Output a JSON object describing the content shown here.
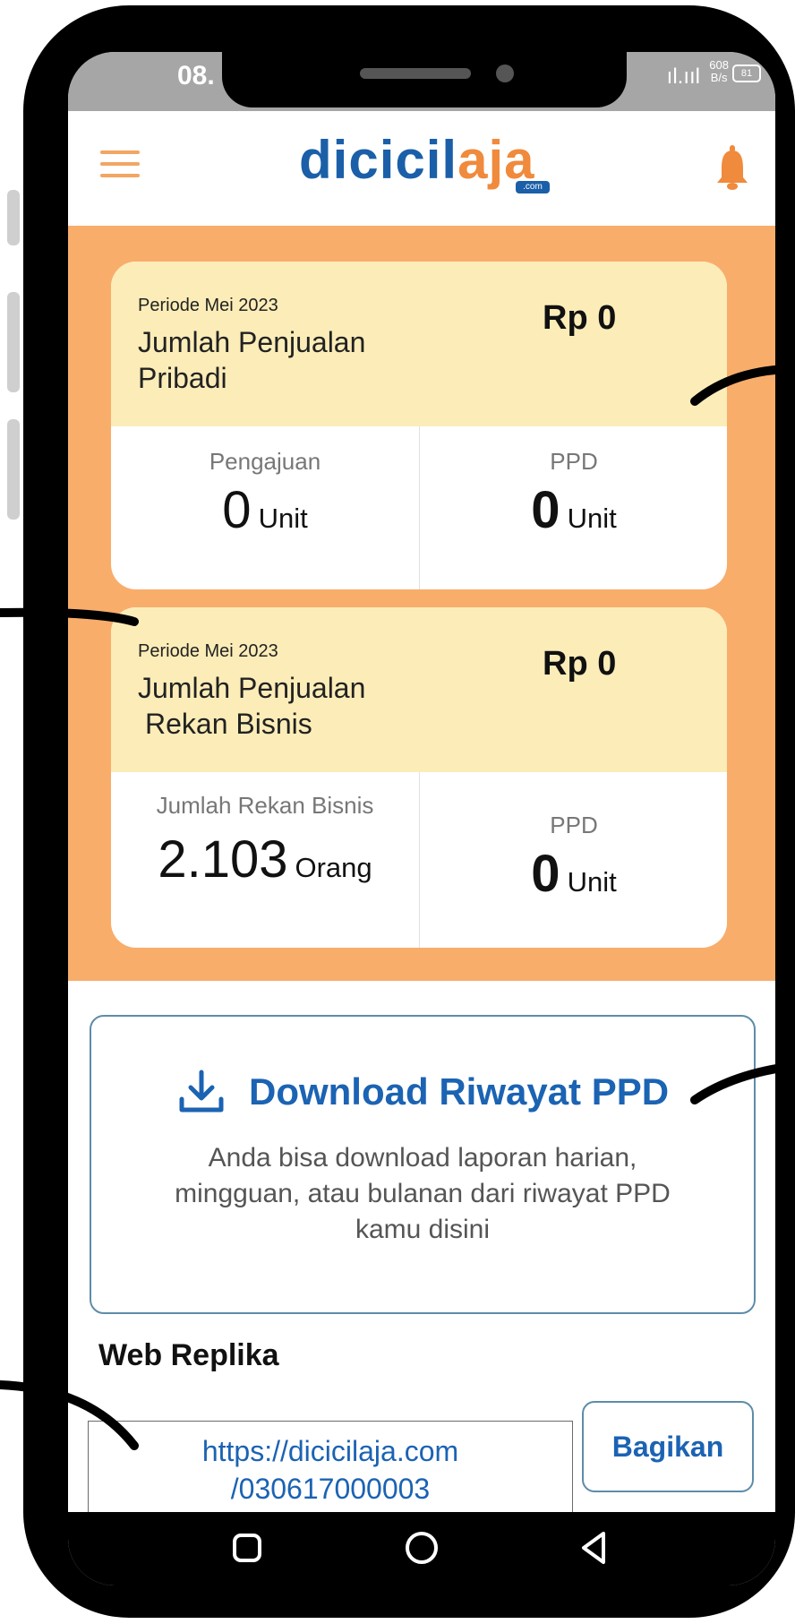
{
  "status_bar": {
    "time": "08.",
    "signal": "ıl.ııl",
    "net_speed_value": "608",
    "net_speed_unit": "B/s",
    "battery": "81"
  },
  "header": {
    "logo_part1": "dicicil",
    "logo_part2": "aja",
    "logo_suffix": ".com",
    "menu_icon": "hamburger-icon",
    "bell_icon": "bell-icon"
  },
  "personal_sales": {
    "period": "Periode Mei 2023",
    "title_line1": "Jumlah Penjualan",
    "title_line2": "Pribadi",
    "amount": "Rp 0",
    "left_label": "Pengajuan",
    "left_value": "0",
    "left_unit": "Unit",
    "right_label": "PPD",
    "right_value": "0",
    "right_unit": "Unit"
  },
  "partner_sales": {
    "period": "Periode Mei 2023",
    "title_line1": "Jumlah Penjualan",
    "title_line2": "Rekan Bisnis",
    "amount": "Rp 0",
    "left_label": "Jumlah Rekan Bisnis",
    "left_value": "2.103",
    "left_unit": "Orang",
    "right_label": "PPD",
    "right_value": "0",
    "right_unit": "Unit"
  },
  "download": {
    "title": "Download Riwayat PPD",
    "description": "Anda bisa download laporan harian, mingguan, atau bulanan dari riwayat PPD kamu disini",
    "icon": "download-icon"
  },
  "web_replika": {
    "heading": "Web Replika",
    "url_line1": "https://dicicilaja.com",
    "url_line2": "/030617000003",
    "share_label": "Bagikan"
  },
  "nav_bar": {
    "recent": "square-icon",
    "home": "circle-icon",
    "back": "triangle-back-icon"
  },
  "colors": {
    "brand_blue": "#1b5fa8",
    "brand_orange": "#f08a3c",
    "panel_orange": "#f9ad6b",
    "card_header": "#fcedb8"
  }
}
